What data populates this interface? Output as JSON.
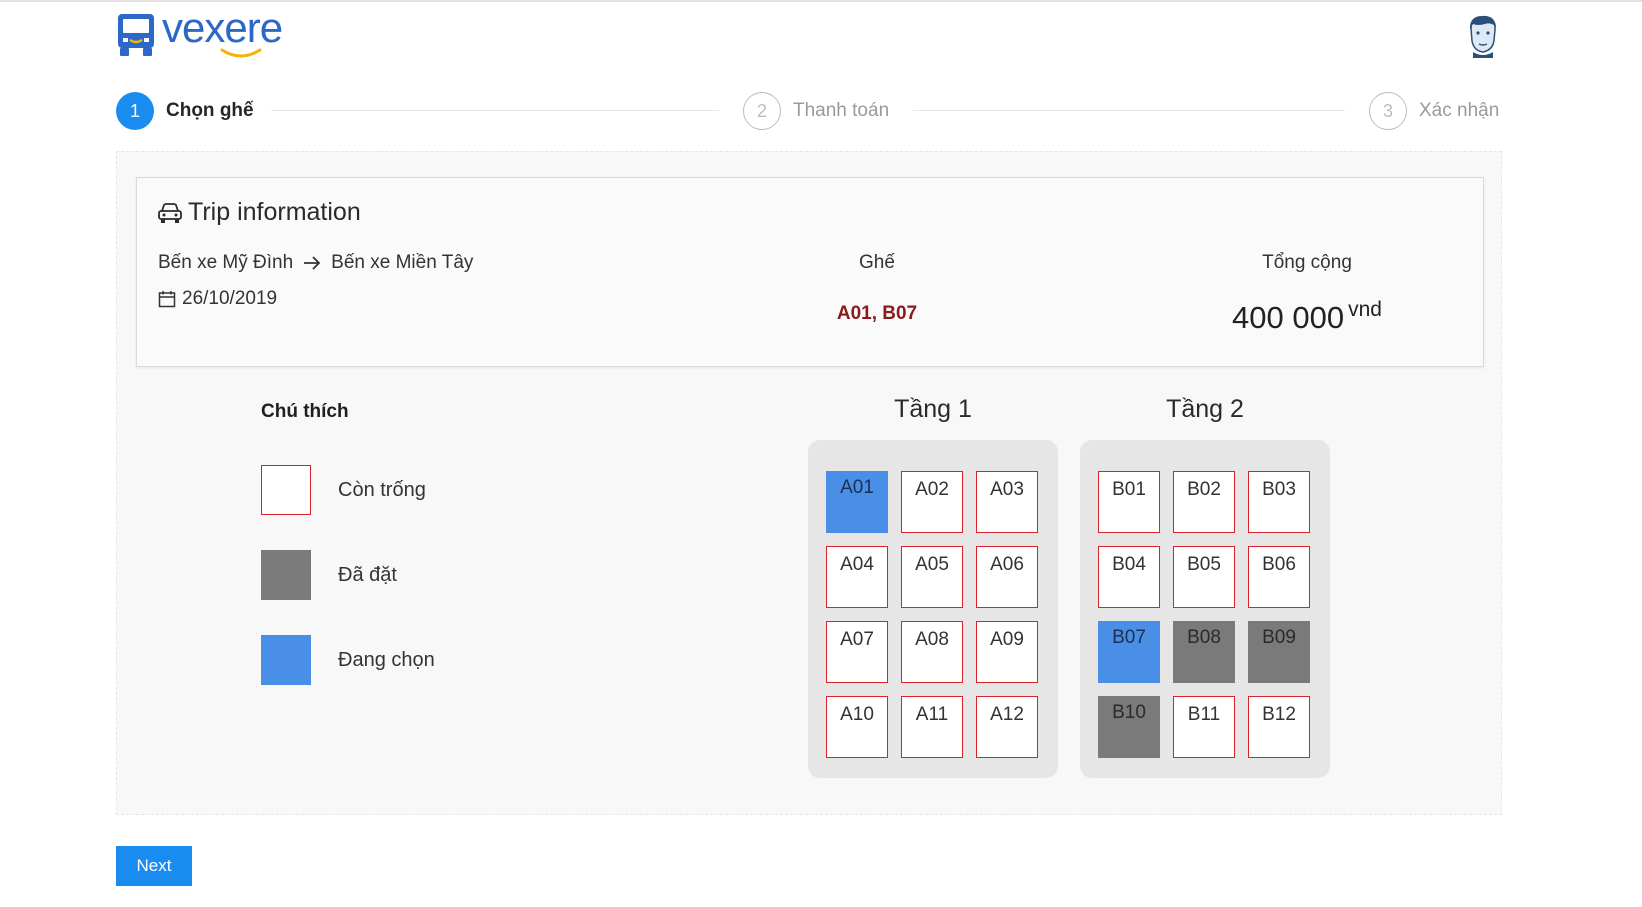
{
  "app": {
    "logo_text": "vexere"
  },
  "steps": [
    {
      "number": "1",
      "label": "Chọn ghế",
      "state": "active"
    },
    {
      "number": "2",
      "label": "Thanh toán",
      "state": "inactive"
    },
    {
      "number": "3",
      "label": "Xác nhận",
      "state": "inactive"
    }
  ],
  "trip": {
    "title": "Trip information",
    "from": "Bến xe Mỹ Đình",
    "to": "Bến xe Miền Tây",
    "date": "26/10/2019",
    "seat_header": "Ghế",
    "seats_selected": "A01,  B07",
    "total_header": "Tổng cộng",
    "total_value": "400 000",
    "total_unit": "vnd"
  },
  "legend": {
    "title": "Chú thích",
    "items": [
      {
        "label": "Còn trống",
        "state": "available"
      },
      {
        "label": "Đã đặt",
        "state": "booked"
      },
      {
        "label": "Đang chọn",
        "state": "selected"
      }
    ]
  },
  "floors": [
    {
      "title": "Tầng 1",
      "seats": [
        {
          "code": "A01",
          "state": "selected"
        },
        {
          "code": "A02",
          "state": "available"
        },
        {
          "code": "A03",
          "state": "available"
        },
        {
          "code": "A04",
          "state": "available"
        },
        {
          "code": "A05",
          "state": "available"
        },
        {
          "code": "A06",
          "state": "available"
        },
        {
          "code": "A07",
          "state": "available"
        },
        {
          "code": "A08",
          "state": "available"
        },
        {
          "code": "A09",
          "state": "available"
        },
        {
          "code": "A10",
          "state": "available"
        },
        {
          "code": "A11",
          "state": "available"
        },
        {
          "code": "A12",
          "state": "available"
        }
      ]
    },
    {
      "title": "Tầng 2",
      "seats": [
        {
          "code": "B01",
          "state": "available"
        },
        {
          "code": "B02",
          "state": "available"
        },
        {
          "code": "B03",
          "state": "available"
        },
        {
          "code": "B04",
          "state": "available"
        },
        {
          "code": "B05",
          "state": "available"
        },
        {
          "code": "B06",
          "state": "available"
        },
        {
          "code": "B07",
          "state": "selected"
        },
        {
          "code": "B08",
          "state": "booked"
        },
        {
          "code": "B09",
          "state": "booked"
        },
        {
          "code": "B10",
          "state": "booked"
        },
        {
          "code": "B11",
          "state": "available"
        },
        {
          "code": "B12",
          "state": "available"
        }
      ]
    }
  ],
  "actions": {
    "next_label": "Next"
  },
  "colors": {
    "brand_blue": "#2c68c7",
    "accent_blue": "#1a8cf0",
    "available_border": "#d8232a",
    "booked": "#7a7a7a",
    "selected": "#4a8fe7",
    "seat_code_red": "#8b1a1a"
  }
}
